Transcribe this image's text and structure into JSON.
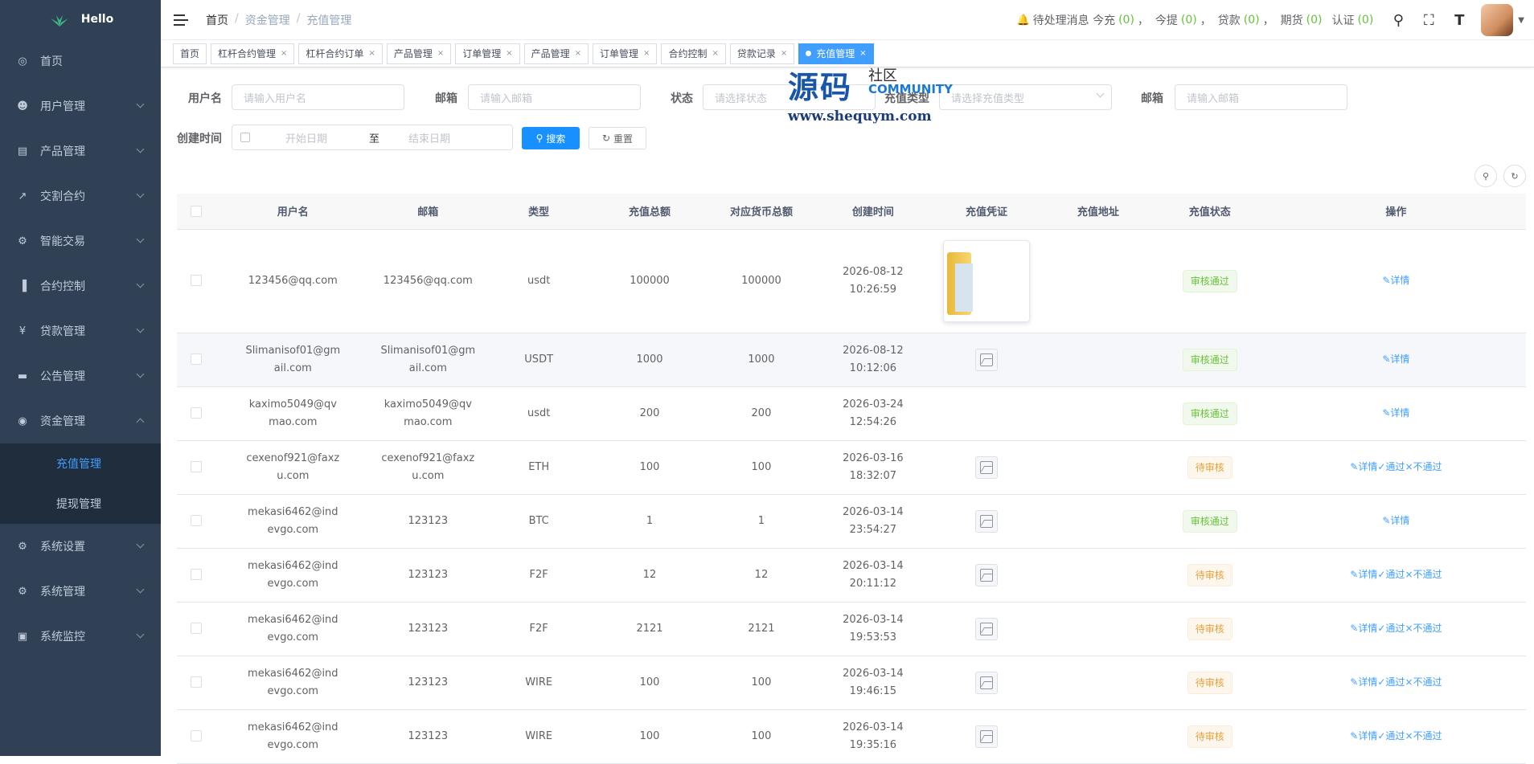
{
  "app": {
    "logo_text": "Hello"
  },
  "sidebar": {
    "items": [
      {
        "label": "首页",
        "icon": "dashboard-icon",
        "expandable": false
      },
      {
        "label": "用户管理",
        "icon": "user-icon",
        "expandable": true
      },
      {
        "label": "产品管理",
        "icon": "document-icon",
        "expandable": true
      },
      {
        "label": "交割合约",
        "icon": "chart-edit-icon",
        "expandable": true
      },
      {
        "label": "智能交易",
        "icon": "gear-icon",
        "expandable": true
      },
      {
        "label": "合约控制",
        "icon": "bar-chart-icon",
        "expandable": true
      },
      {
        "label": "贷款管理",
        "icon": "money-icon",
        "expandable": true
      },
      {
        "label": "公告管理",
        "icon": "message-icon",
        "expandable": true
      },
      {
        "label": "资金管理",
        "icon": "funds-icon",
        "expandable": true,
        "expanded": true,
        "children": [
          {
            "label": "充值管理",
            "active": true
          },
          {
            "label": "提现管理",
            "active": false
          }
        ]
      },
      {
        "label": "系统设置",
        "icon": "settings-icon",
        "expandable": true
      },
      {
        "label": "系统管理",
        "icon": "settings-icon",
        "expandable": true
      },
      {
        "label": "系统监控",
        "icon": "monitor-icon",
        "expandable": true
      }
    ]
  },
  "navbar": {
    "breadcrumb": [
      "首页",
      "资金管理",
      "充值管理"
    ],
    "pending": {
      "label": "待处理消息 今充",
      "recharge": "(0)",
      "withdraw_label": "今提",
      "withdraw": "(0)",
      "loan_label": "贷款",
      "loan": "(0)",
      "futures_label": "期货",
      "futures": "(0)",
      "auth_label": "认证",
      "auth": "(0)",
      "sep": "，"
    }
  },
  "tags": [
    {
      "label": "首页",
      "closable": false,
      "active": false
    },
    {
      "label": "杠杆合约管理",
      "closable": true,
      "active": false
    },
    {
      "label": "杠杆合约订单",
      "closable": true,
      "active": false
    },
    {
      "label": "产品管理",
      "closable": true,
      "active": false
    },
    {
      "label": "订单管理",
      "closable": true,
      "active": false
    },
    {
      "label": "产品管理",
      "closable": true,
      "active": false
    },
    {
      "label": "订单管理",
      "closable": true,
      "active": false
    },
    {
      "label": "合约控制",
      "closable": true,
      "active": false
    },
    {
      "label": "贷款记录",
      "closable": true,
      "active": false
    },
    {
      "label": "充值管理",
      "closable": true,
      "active": true
    }
  ],
  "search": {
    "username_label": "用户名",
    "username_placeholder": "请输入用户名",
    "email_label": "邮箱",
    "email_placeholder": "请输入邮箱",
    "status_label": "状态",
    "status_placeholder": "请选择状态",
    "type_label": "充值类型",
    "type_placeholder": "请选择充值类型",
    "email2_label": "邮箱",
    "email2_placeholder": "请输入邮箱",
    "created_label": "创建时间",
    "start_placeholder": "开始日期",
    "range_sep": "至",
    "end_placeholder": "结束日期",
    "search_button": "搜索",
    "reset_button": "重置"
  },
  "watermark": {
    "big": "源码",
    "cn": "社区",
    "en": "COMMUNITY",
    "url": "www.shequym.com"
  },
  "table": {
    "columns": [
      "用户名",
      "邮箱",
      "类型",
      "充值总额",
      "对应货币总额",
      "创建时间",
      "充值凭证",
      "充值地址",
      "充值状态",
      "操作"
    ],
    "op_labels": {
      "detail": "详情",
      "approve": "通过",
      "reject": "不通过"
    },
    "rows": [
      {
        "username": "123456@qq.com",
        "email": "123456@qq.com",
        "type": "usdt",
        "amount": "100000",
        "currency_total": "100000",
        "created": "2026-08-12 10:26:59",
        "voucher": "thumbnail",
        "address": "",
        "status": "审核通过",
        "status_kind": "ok",
        "actions": [
          "detail"
        ]
      },
      {
        "username": "Slimanisof01@gmail.com",
        "email": "Slimanisof01@gmail.com",
        "type": "USDT",
        "amount": "1000",
        "currency_total": "1000",
        "created": "2026-08-12 10:12:06",
        "voucher": "placeholder",
        "address": "",
        "status": "审核通过",
        "status_kind": "ok",
        "actions": [
          "detail"
        ]
      },
      {
        "username": "kaximo5049@qvmao.com",
        "email": "kaximo5049@qvmao.com",
        "type": "usdt",
        "amount": "200",
        "currency_total": "200",
        "created": "2026-03-24 12:54:26",
        "voucher": "none",
        "address": "",
        "status": "审核通过",
        "status_kind": "ok",
        "actions": [
          "detail"
        ]
      },
      {
        "username": "cexenof921@faxzu.com",
        "email": "cexenof921@faxzu.com",
        "type": "ETH",
        "amount": "100",
        "currency_total": "100",
        "created": "2026-03-16 18:32:07",
        "voucher": "placeholder",
        "address": "",
        "status": "待审核",
        "status_kind": "wait",
        "actions": [
          "detail",
          "approve",
          "reject"
        ]
      },
      {
        "username": "mekasi6462@indevgo.com",
        "email": "123123",
        "type": "BTC",
        "amount": "1",
        "currency_total": "1",
        "created": "2026-03-14 23:54:27",
        "voucher": "placeholder",
        "address": "",
        "status": "审核通过",
        "status_kind": "ok",
        "actions": [
          "detail"
        ]
      },
      {
        "username": "mekasi6462@indevgo.com",
        "email": "123123",
        "type": "F2F",
        "amount": "12",
        "currency_total": "12",
        "created": "2026-03-14 20:11:12",
        "voucher": "placeholder",
        "address": "",
        "status": "待审核",
        "status_kind": "wait",
        "actions": [
          "detail",
          "approve",
          "reject"
        ]
      },
      {
        "username": "mekasi6462@indevgo.com",
        "email": "123123",
        "type": "F2F",
        "amount": "2121",
        "currency_total": "2121",
        "created": "2026-03-14 19:53:53",
        "voucher": "placeholder",
        "address": "",
        "status": "待审核",
        "status_kind": "wait",
        "actions": [
          "detail",
          "approve",
          "reject"
        ]
      },
      {
        "username": "mekasi6462@indevgo.com",
        "email": "123123",
        "type": "WIRE",
        "amount": "100",
        "currency_total": "100",
        "created": "2026-03-14 19:46:15",
        "voucher": "placeholder",
        "address": "",
        "status": "待审核",
        "status_kind": "wait",
        "actions": [
          "detail",
          "approve",
          "reject"
        ]
      },
      {
        "username": "mekasi6462@indevgo.com",
        "email": "123123",
        "type": "WIRE",
        "amount": "100",
        "currency_total": "100",
        "created": "2026-03-14 19:35:16",
        "voucher": "placeholder",
        "address": "",
        "status": "待审核",
        "status_kind": "wait",
        "actions": [
          "detail",
          "approve",
          "reject"
        ]
      }
    ]
  },
  "colors": {
    "sidebar_bg": "#304156",
    "submenu_bg": "#1f2d3d",
    "accent": "#409eff",
    "success": "#67c23a",
    "warning": "#e6a23c"
  }
}
